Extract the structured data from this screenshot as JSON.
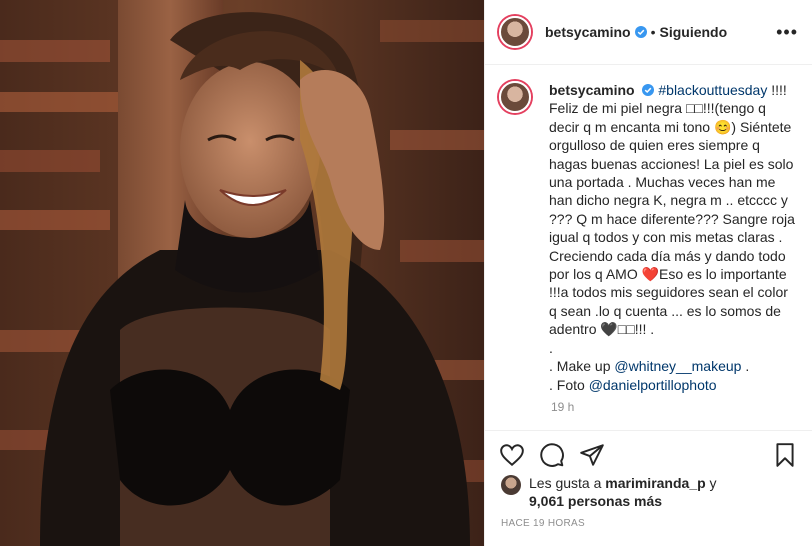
{
  "post": {
    "username": "betsycamino",
    "follow_dot": "•",
    "follow_label": "Siguiendo",
    "more_label": "•••"
  },
  "caption": {
    "username": "betsycamino",
    "hashtag": "#blackouttuesday",
    "line1_after": " !!!! Feliz de mi piel negra □□!!!(tengo q decir q m encanta mi tono 😊) Siéntete orgulloso de quien eres siempre q hagas buenas acciones! La piel es solo una portada . Muchas veces han me han dicho negra K, negra m .. etcccc y ??? Q m hace diferente??? Sangre roja igual q todos y con mis metas claras . Creciendo cada día más y dando todo por los q AMO ❤️Eso es lo importante !!!a todos mis seguidores sean el color q sean .lo q cuenta ... es lo somos de adentro 🖤□□!!! .",
    "dot_line": ".",
    "makeup_prefix": ". Make up ",
    "makeup_handle": "@whitney__makeup",
    "makeup_suffix": " .",
    "foto_prefix": ". Foto ",
    "foto_handle": "@danielportillophoto"
  },
  "time_short": "19 h",
  "likes": {
    "prefix": "Les gusta a ",
    "user": "marimiranda_p",
    "middle": " y ",
    "count": "9,061 personas más"
  },
  "time_ago": "HACE 19 HORAS",
  "icons": [
    "heart-icon",
    "comment-icon",
    "share-icon",
    "save-icon",
    "verified-icon"
  ],
  "colors": {
    "link": "#00376b",
    "verified": "#3897f0",
    "muted": "#8e8e8e",
    "ring": "#e4405f"
  }
}
